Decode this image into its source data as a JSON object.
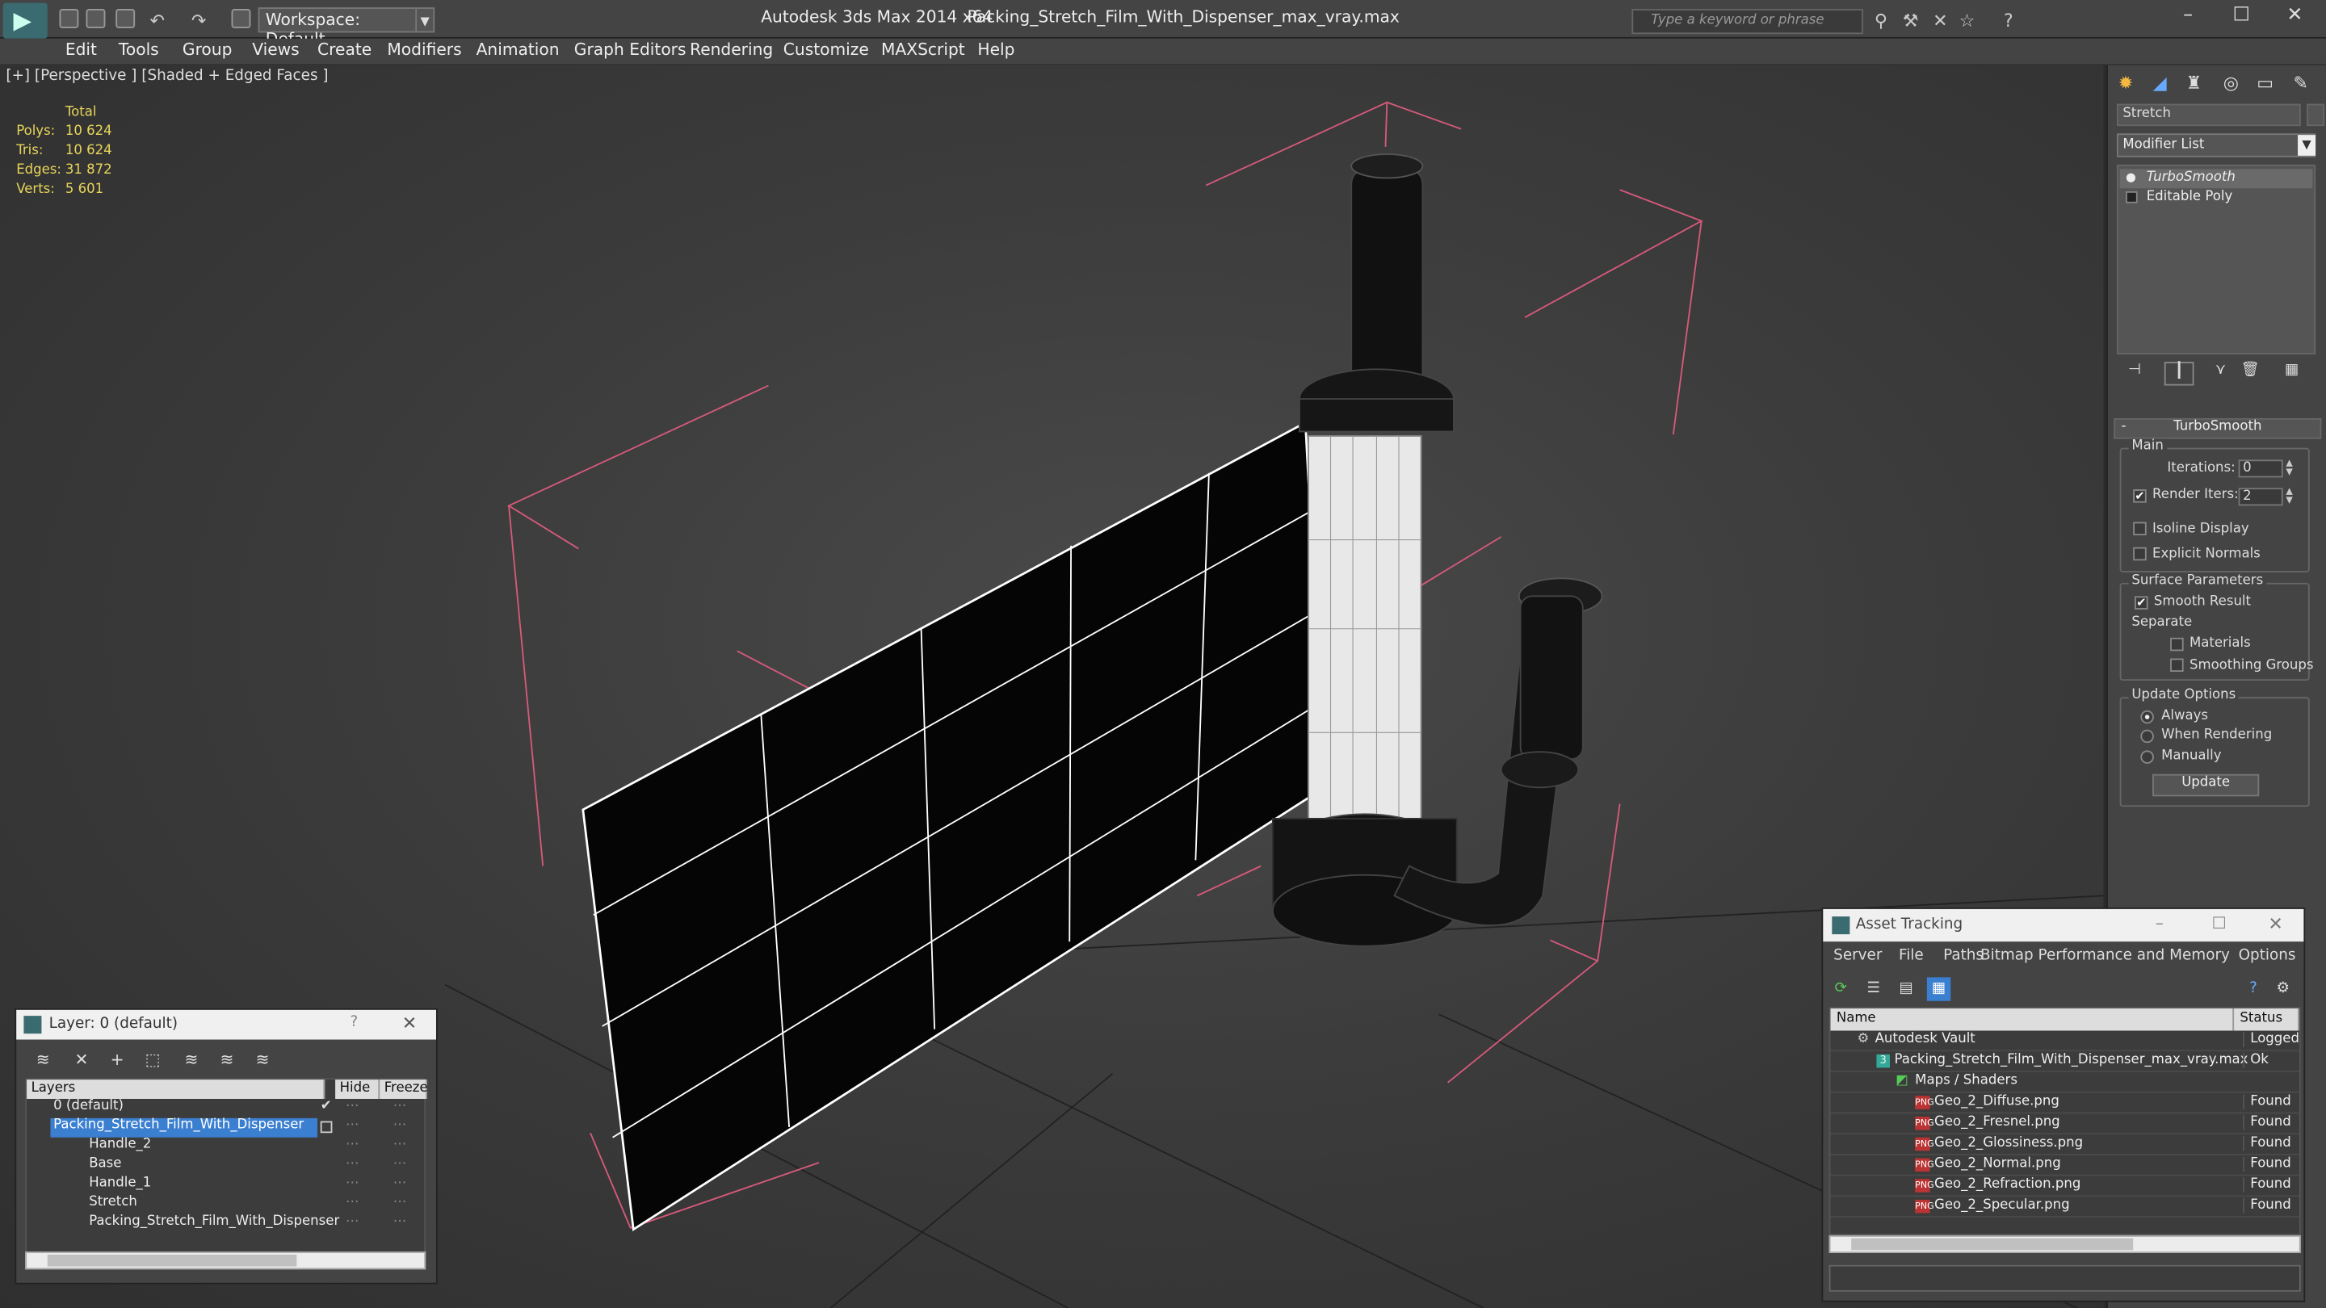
{
  "titlebar": {
    "workspace": "Workspace: Default",
    "app_title": "Autodesk 3ds Max  2014 x64",
    "file_title": "Packing_Stretch_Film_With_Dispenser_max_vray.max",
    "search_placeholder": "Type a keyword or phrase"
  },
  "menu": [
    "Edit",
    "Tools",
    "Group",
    "Views",
    "Create",
    "Modifiers",
    "Animation",
    "Graph Editors",
    "Rendering",
    "Customize",
    "MAXScript",
    "Help"
  ],
  "viewport": {
    "label": "[+] [Perspective ] [Shaded + Edged Faces ]",
    "stats": {
      "header": "Total",
      "rows": [
        {
          "label": "Polys:",
          "value": "10 624"
        },
        {
          "label": "Tris:",
          "value": "10 624"
        },
        {
          "label": "Edges:",
          "value": "31 872"
        },
        {
          "label": "Verts:",
          "value": "5 601"
        }
      ]
    }
  },
  "command_panel": {
    "object_name": "Stretch",
    "modifier_list": "Modifier List",
    "stack": [
      "TurboSmooth",
      "Editable Poly"
    ],
    "rollout_title": "TurboSmooth",
    "main_group": "Main",
    "iterations_label": "Iterations:",
    "iterations_value": "0",
    "render_iters_label": "Render Iters:",
    "render_iters_value": "2",
    "isoline": "Isoline Display",
    "explicit": "Explicit Normals",
    "surface_group": "Surface Parameters",
    "smooth_result": "Smooth Result",
    "separate": "Separate",
    "materials": "Materials",
    "smoothing_groups": "Smoothing Groups",
    "update_group": "Update Options",
    "always": "Always",
    "when_rendering": "When Rendering",
    "manually": "Manually",
    "update_button": "Update"
  },
  "layer_dialog": {
    "title": "Layer: 0 (default)",
    "columns": [
      "Layers",
      "Hide",
      "Freeze"
    ],
    "rows": [
      {
        "name": "0 (default)",
        "indent": 0
      },
      {
        "name": "Packing_Stretch_Film_With_Dispenser",
        "indent": 0
      },
      {
        "name": "Handle_2",
        "indent": 1
      },
      {
        "name": "Base",
        "indent": 1
      },
      {
        "name": "Handle_1",
        "indent": 1
      },
      {
        "name": "Stretch",
        "indent": 1
      },
      {
        "name": "Packing_Stretch_Film_With_Dispenser",
        "indent": 1
      }
    ]
  },
  "asset_tracking": {
    "title": "Asset Tracking",
    "menu": [
      "Server",
      "File",
      "Paths",
      "Bitmap Performance and Memory",
      "Options"
    ],
    "columns": [
      "Name",
      "Status"
    ],
    "rows": [
      {
        "name": "Autodesk Vault",
        "status": "Logged C"
      },
      {
        "name": "Packing_Stretch_Film_With_Dispenser_max_vray.max",
        "status": "Ok"
      },
      {
        "name": "Maps / Shaders",
        "status": ""
      },
      {
        "name": "Geo_2_Diffuse.png",
        "status": "Found"
      },
      {
        "name": "Geo_2_Fresnel.png",
        "status": "Found"
      },
      {
        "name": "Geo_2_Glossiness.png",
        "status": "Found"
      },
      {
        "name": "Geo_2_Normal.png",
        "status": "Found"
      },
      {
        "name": "Geo_2_Refraction.png",
        "status": "Found"
      },
      {
        "name": "Geo_2_Specular.png",
        "status": "Found"
      }
    ]
  },
  "colors": {
    "selection": "#3a7fd0",
    "stat_text": "#e8d55a",
    "bbox_lines": "#d65a7a"
  }
}
